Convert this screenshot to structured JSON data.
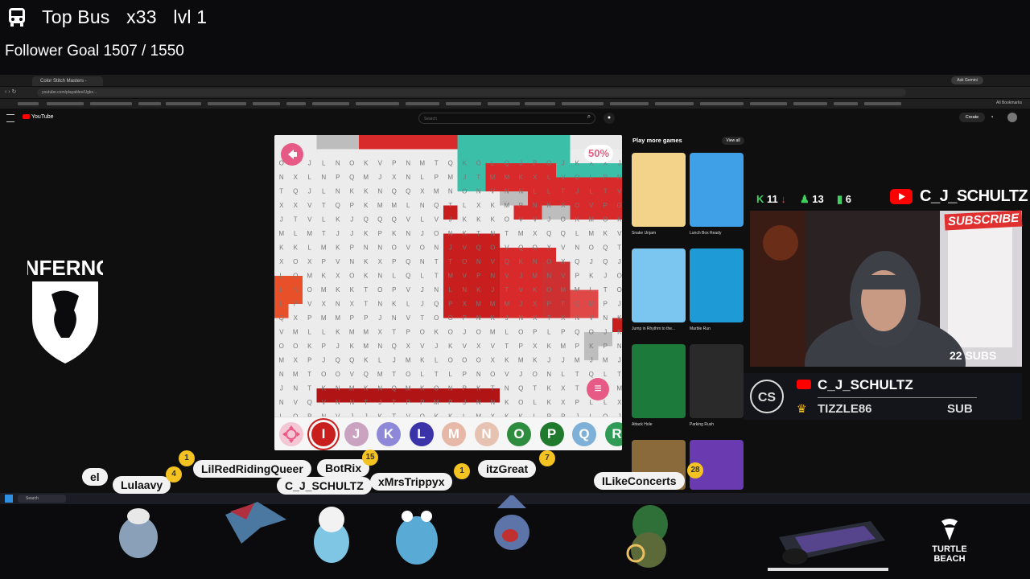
{
  "hud": {
    "bus_label": "Top Bus",
    "bus_multiplier": "x33",
    "bus_level": "lvl 1",
    "follower_goal_label": "Follower Goal",
    "follower_goal_current": "1507",
    "follower_goal_target": "1550",
    "follower_goal_text": "Follower Goal 1507 / 1550"
  },
  "browser": {
    "tab_title": "Color Stitch Masters - YouTube",
    "url": "youtube.com/playables/Ugkx...",
    "ask_gemini": "Ask Gemini",
    "all_bookmarks": "All Bookmarks"
  },
  "youtube": {
    "logo_text": "YouTube",
    "search_placeholder": "Search",
    "create_label": "Create"
  },
  "game": {
    "progress": "50%",
    "progress_value": 0.5,
    "palette": [
      {
        "letter": "I",
        "color": "#c81e1e",
        "selected": true
      },
      {
        "letter": "J",
        "color": "#c9a3c0",
        "selected": false
      },
      {
        "letter": "K",
        "color": "#8e88d9",
        "selected": false
      },
      {
        "letter": "L",
        "color": "#3a34a8",
        "selected": false
      },
      {
        "letter": "M",
        "color": "#e7b8a8",
        "selected": false
      },
      {
        "letter": "N",
        "color": "#e6c2b2",
        "selected": false
      },
      {
        "letter": "O",
        "color": "#2e8c3e",
        "selected": false
      },
      {
        "letter": "P",
        "color": "#1f7a2e",
        "selected": false
      },
      {
        "letter": "Q",
        "color": "#7fb0d8",
        "selected": false
      },
      {
        "letter": "R",
        "color": "#2f9b56",
        "selected": false
      }
    ]
  },
  "play_more_games": {
    "title": "Play more games",
    "view_all": "View all",
    "games": [
      {
        "name": "Snake Unjam",
        "color": "#f3d28a"
      },
      {
        "name": "Lunch Box Ready",
        "color": "#3fa0e8"
      },
      {
        "name": "Jump in Rhythm to the...",
        "color": "#7ac6f0"
      },
      {
        "name": "Marble Run",
        "color": "#1e9ad6"
      },
      {
        "name": "Attack Hole",
        "color": "#1c7a3a"
      },
      {
        "name": "Parking Rush",
        "color": "#2a2a2a"
      }
    ]
  },
  "stream": {
    "kills": "11",
    "stat_green": "13",
    "stat_bars": "6",
    "channel": "C_J_SCHULTZ",
    "subs": "22 SUBS",
    "subscribe": "SUBSCRIBE",
    "latest_name": "C_J_SCHULTZ",
    "latest_sub": "TIZZLE86",
    "sub_tag": "SUB",
    "sponsor_left": "INFERNO",
    "sponsor_right": "TURTLE BEACH"
  },
  "chatters": [
    {
      "name": "el",
      "level": ""
    },
    {
      "name": "Lulaavy",
      "level": "4"
    },
    {
      "name": "LilRedRidingQueer",
      "level": "1"
    },
    {
      "name": "BotRix",
      "level": "15"
    },
    {
      "name": "C_J_SCHULTZ",
      "level": ""
    },
    {
      "name": "xMrsTrippyx",
      "level": "1"
    },
    {
      "name": "itzGreat",
      "level": "7"
    },
    {
      "name": "ILikeConcerts",
      "level": "28"
    }
  ]
}
